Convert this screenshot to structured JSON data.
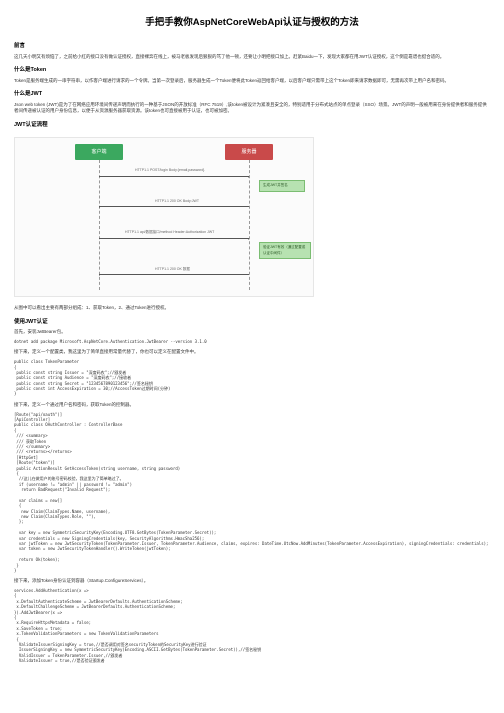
{
  "title": "手把手教你AspNetCoreWebApi认证与授权的方法",
  "sections": {
    "preface_h": "前言",
    "preface_p": "这几天小明又有烦恼了，之前给小红的接口没有做认证授权，直接裸奔在线上，被马老板发现后狠狠的骂了他一顿，还要让小明把接口加上。赶紧Baidu一下，发现大家都在用JWT认证授权，这个倒是靠谱也挺合适的。",
    "what_token_h": "什么是Token",
    "what_token_p": "Token是服务端生成的一串字符串，以作客户端进行请求的一个令牌。当第一次登录后，服务器生成一个Token便将此Token返回给客户端，以后客户端只需带上这个Token即来请求数据即可，无需再次带上用户名和密码。",
    "what_jwt_h": "什么是JWT",
    "what_jwt_p": "Json web token (JWT)是为了在网络应用环境间传递声明而执行的一种基于JSON的开放标准（RFC 7519）,该token被设计为紧凑且安全的，特别适用于分布式站点的单点登录（SSO）场景。JWT的声明一般被用来在身份提供者和服务提供者间传递被认证的用户身份信息，以便于从资源服务器获取资源。该token也可直接被用于认证，也可被加密。",
    "jwt_flow_h": "JWT认证流程",
    "diagram": {
      "client": "客户端",
      "server": "服务器",
      "msg1": "HTTP1.1 POST/login\\nBody:{email,password}",
      "note1": "生成JWT并签名",
      "msg2": "HTTP1.1 200 OK\\nBody:JWT",
      "msg3": "HTTP1.1 api/数据接口/method\\nHeader:Authorization JWT",
      "note2": "验证JWT有效（通过配置或认证中间件）",
      "msg4": "HTTP1.1 200 OK\\n数据"
    },
    "flow_summary": "从图中可以看出主要有两部分组成：1、获取Token，2、通过Token进行授权。",
    "use_jwt_h": "使用JWT认证",
    "step1": "首先，安装JwtBearer包。",
    "code_install": "dotnet add package Microsoft.AspNetCore.Authentication.JwtBearer --version 3.1.0",
    "step2": "接下来，定义一个配置类，我这里为了简单直接用常量代替了，你也可以定义在配置文件中。",
    "code_tokenparam": "public class TokenParameter\n{\n public const string Issuer = \"深度码农\";//颁发者\n public const string Audience = \"深度码农\";//接收者\n public const string Secret = \"1234567890123456\";//签名秘钥\n public const int AccessExpiration = 30;//AccessToken过期时间(分钟)\n}",
    "step3": "接下来，定义一个通过用户名和密码，获取Token的控制器。",
    "code_controller": "[Route(\"api/oauth\")]\n[ApiController]\npublic class OAuthController : ControllerBase\n{\n /// <summary>\n /// 获取Token\n /// </summary>\n /// <returns></returns>\n [HttpGet]\n [Route(\"token\")]\n public ActionResult GetAccessToken(string username, string password)\n {\n  //这儿在做用户的账号密码校验，我这里为了简单略过了。\n  if (username != \"admin\" || password != \"admin\")\n   return BadRequest(\"Invalid Request\");\n\n  var claims = new[]\n  {\n   new Claim(ClaimTypes.Name, username),\n   new Claim(ClaimTypes.Role, \"\"),\n  };\n\n  var key = new SymmetricSecurityKey(Encoding.UTF8.GetBytes(TokenParameter.Secret));\n  var credentials = new SigningCredentials(key, SecurityAlgorithms.HmacSha256);\n  var jwtToken = new JwtSecurityToken(TokenParameter.Issuer, TokenParameter.Audience, claims, expires: DateTime.UtcNow.AddMinutes(TokenParameter.AccessExpiration), signingCredentials: credentials);\n  var token = new JwtSecurityTokenHandler().WriteToken(jwtToken);\n\n  return Ok(token);\n }\n}",
    "step4": "接下来，添加Token身份认证到容器（Startup.ConfigureServices）。",
    "code_services": "services.AddAuthentication(x =>\n{\n x.DefaultAuthenticateScheme = JwtBearerDefaults.AuthenticationScheme;\n x.DefaultChallengeScheme = JwtBearerDefaults.AuthenticationScheme;\n}).AddJwtBearer(x =>\n{\n x.RequireHttpsMetadata = false;\n x.SaveToken = true;\n x.TokenValidationParameters = new TokenValidationParameters\n {\n  ValidateIssuerSigningKey = true,//是否调用对签名securityToken的SecurityKey进行验证\n  IssuerSigningKey = new SymmetricSecurityKey(Encoding.ASCII.GetBytes(TokenParameter.Secret)),//签名秘钥\n  ValidIssuer = TokenParameter.Issuer,//颁发者\n  ValidateIssuer = true,//是否验证颁发者"
  }
}
